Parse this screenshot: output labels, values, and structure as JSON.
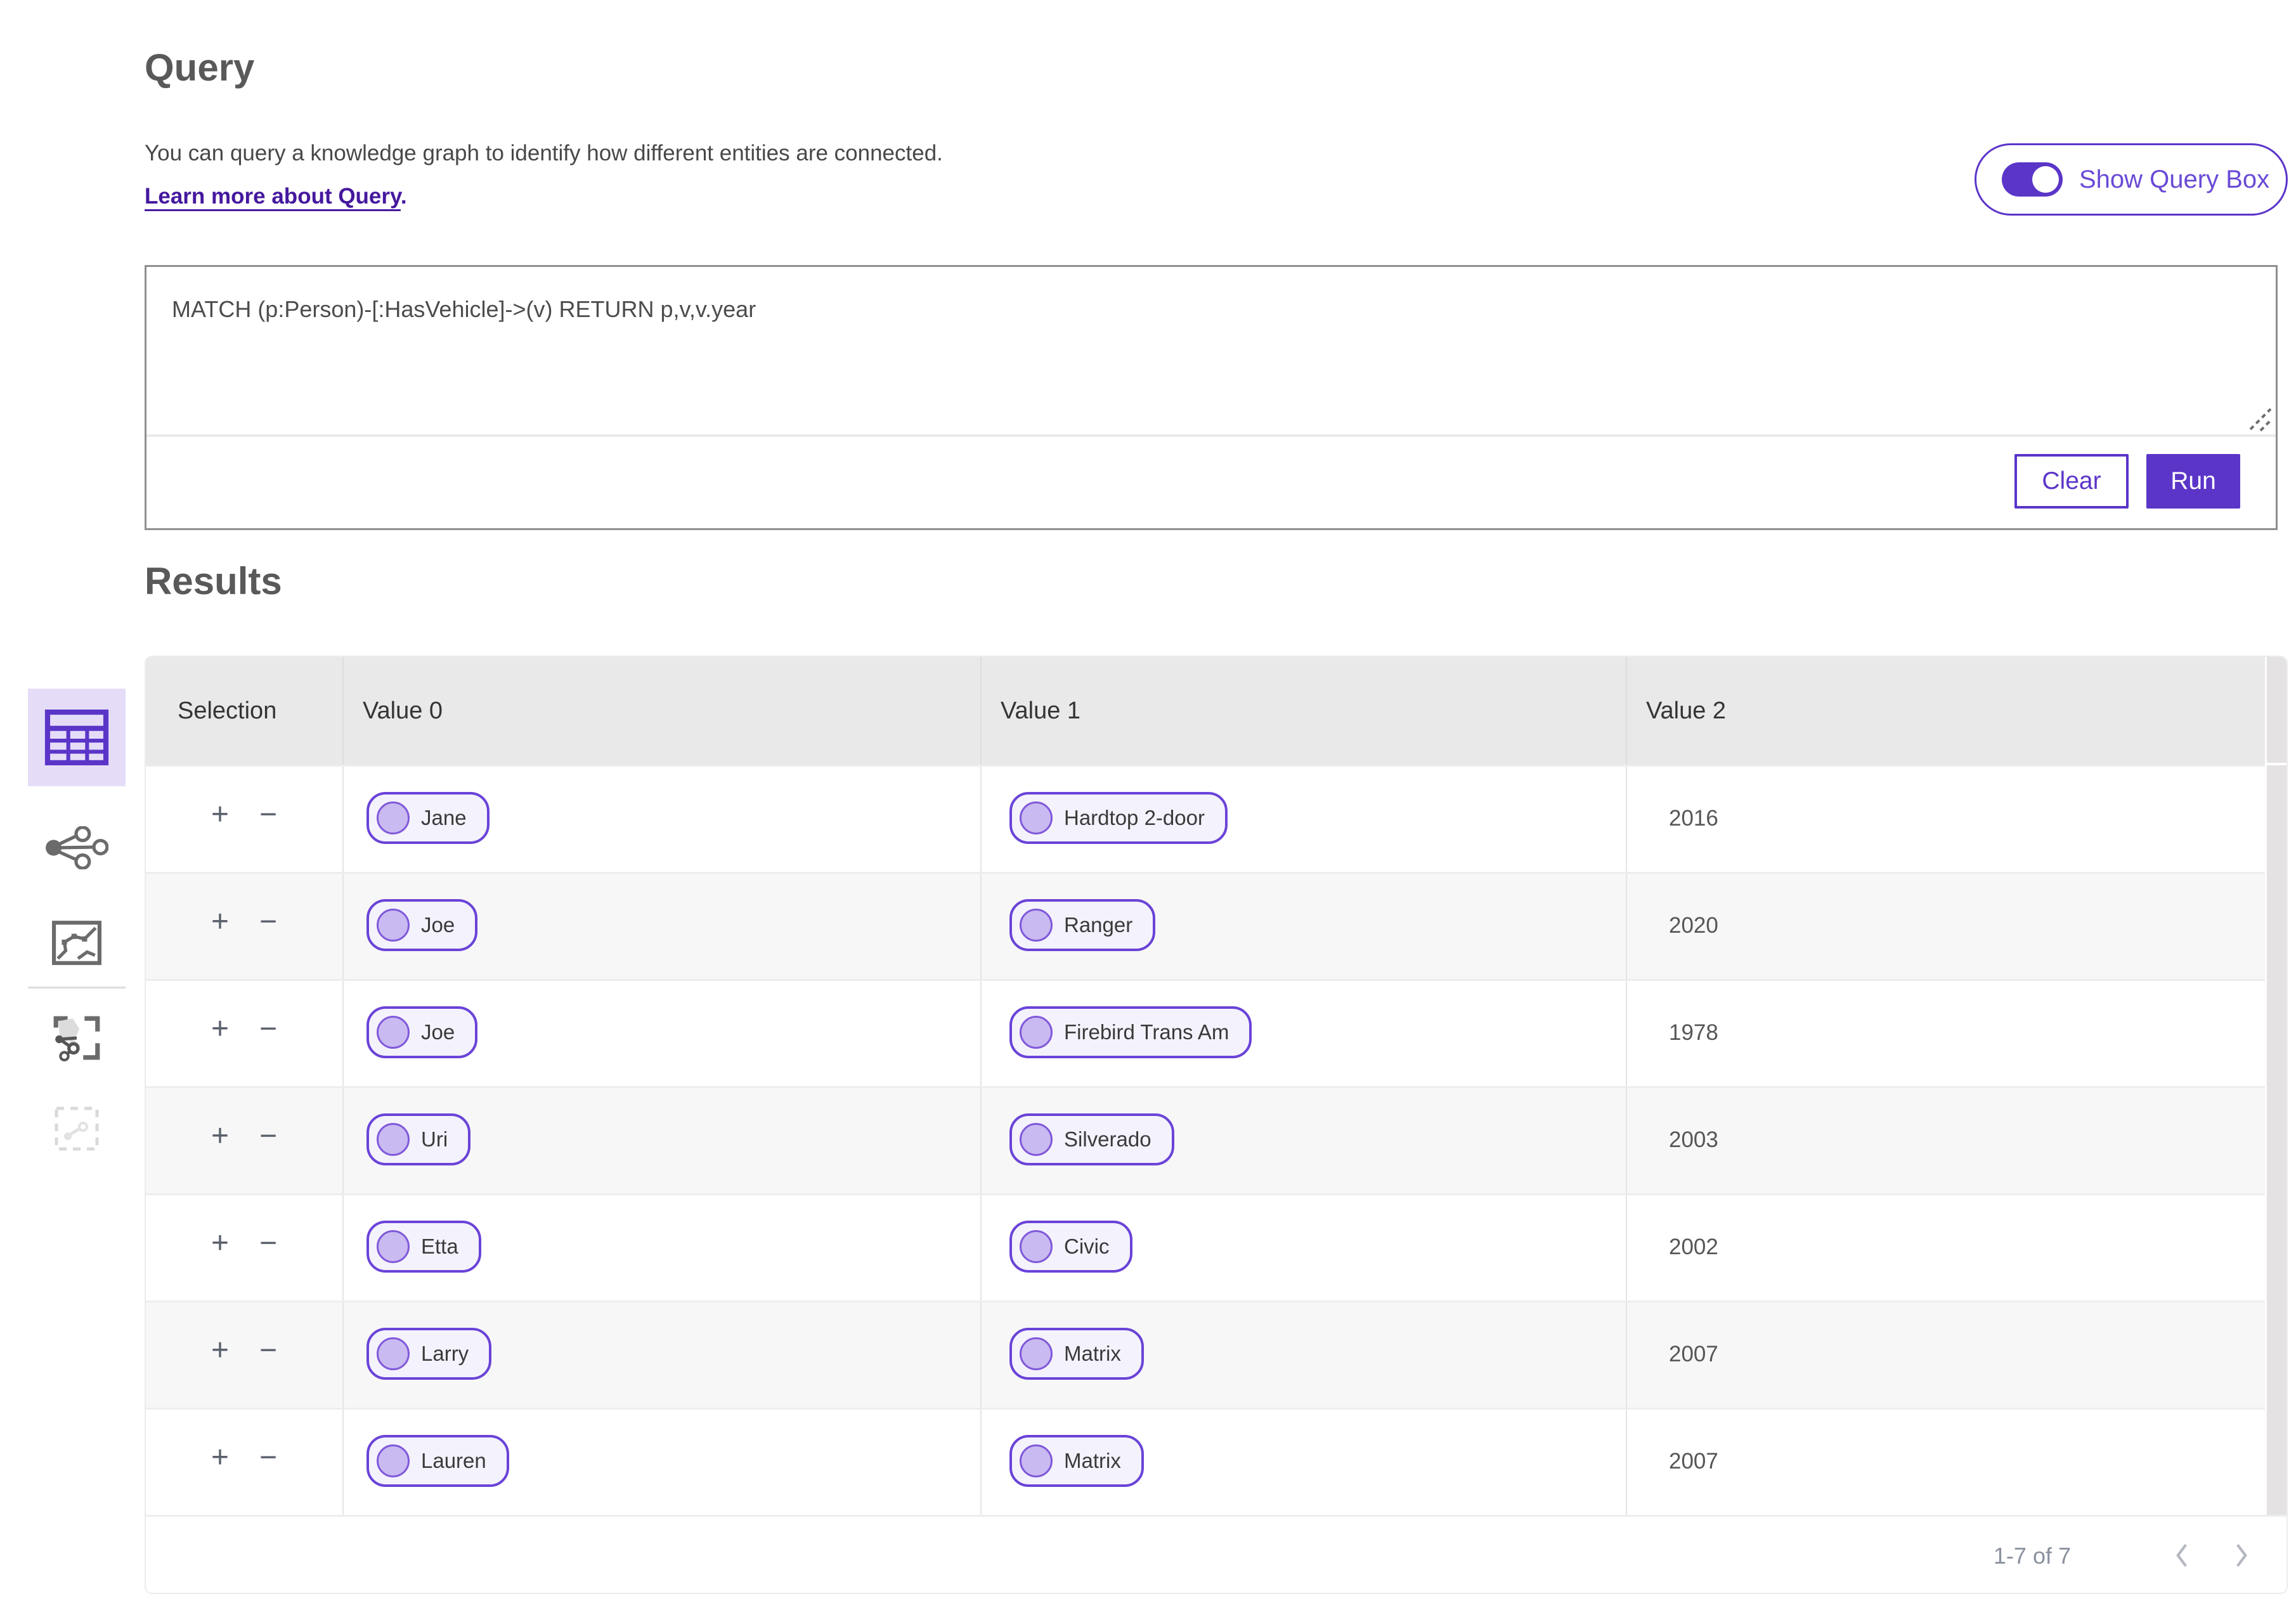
{
  "colors": {
    "accent_purple": "#5b35c8",
    "link_purple": "#45189e",
    "toggle_label_purple": "#6a4ad6",
    "pill_border": "#6a43d8",
    "pill_bg": "#f4f2fc",
    "pill_dot_fill": "#c9baf1",
    "selected_view_bg": "#e5ddf8",
    "table_header_bg": "#e9e9e9",
    "row_alt_bg": "#f7f7f7",
    "heading_gray": "#595959"
  },
  "query_section": {
    "title": "Query",
    "description": "You can query a knowledge graph to identify how different entities are connected.",
    "learn_more_link": "Learn more about Query",
    "learn_more_suffix": ".",
    "toggle_label": "Show Query Box",
    "toggle_state": "on",
    "query_text": "MATCH (p:Person)-[:HasVehicle]->(v) RETURN p,v,v.year",
    "clear_label": "Clear",
    "run_label": "Run"
  },
  "results_section": {
    "title": "Results",
    "view_sidebar": {
      "items": [
        {
          "name": "table-view",
          "selected": true
        },
        {
          "name": "graph-view",
          "selected": false
        },
        {
          "name": "map-view",
          "selected": false
        },
        {
          "name": "subgraph-selection-view",
          "selected": false
        },
        {
          "name": "selection-view",
          "selected": false,
          "disabled": true
        }
      ]
    },
    "table": {
      "columns": [
        "Selection",
        "Value 0",
        "Value 1",
        "Value 2"
      ],
      "row_controls": {
        "add": "+",
        "remove": "−"
      },
      "rows": [
        {
          "value0": "Jane",
          "value1": "Hardtop 2-door",
          "value2": "2016"
        },
        {
          "value0": "Joe",
          "value1": "Ranger",
          "value2": "2020"
        },
        {
          "value0": "Joe",
          "value1": "Firebird Trans Am",
          "value2": "1978"
        },
        {
          "value0": "Uri",
          "value1": "Silverado",
          "value2": "2003"
        },
        {
          "value0": "Etta",
          "value1": "Civic",
          "value2": "2002"
        },
        {
          "value0": "Larry",
          "value1": "Matrix",
          "value2": "2007"
        },
        {
          "value0": "Lauren",
          "value1": "Matrix",
          "value2": "2007"
        }
      ],
      "pagination": {
        "range_text": "1-7 of 7"
      }
    }
  }
}
